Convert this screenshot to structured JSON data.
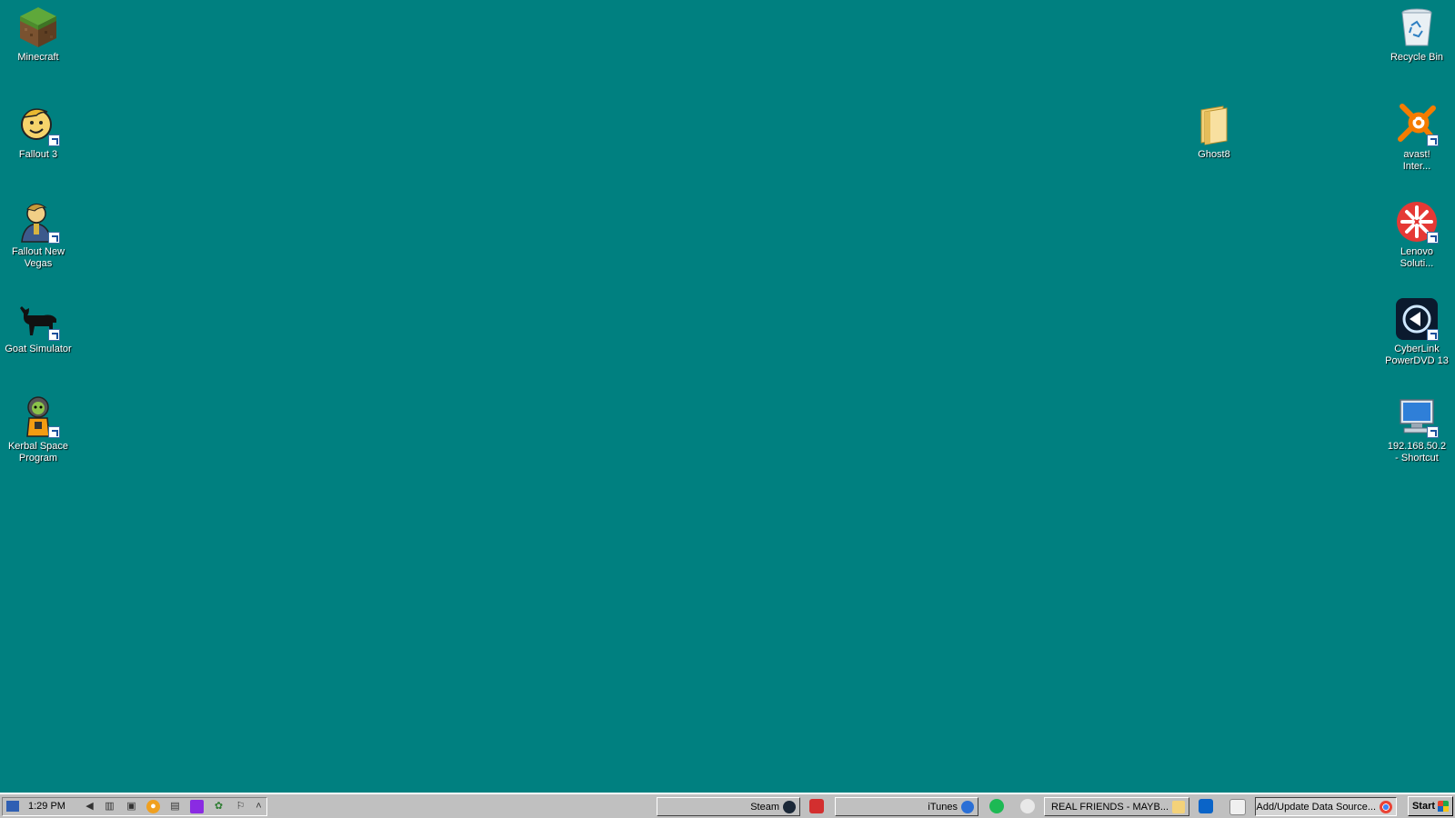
{
  "desktop": {
    "background": "#008080",
    "icons_left": [
      {
        "label": "Minecraft",
        "icon": "minecraft-grass-block-icon",
        "shortcut": false
      },
      {
        "label": "Fallout 3",
        "icon": "vault-boy-icon",
        "shortcut": true
      },
      {
        "label": "Fallout New\nVegas",
        "icon": "vault-boy-new-vegas-icon",
        "shortcut": true
      },
      {
        "label": "Goat Simulator",
        "icon": "goat-icon",
        "shortcut": true
      },
      {
        "label": "Kerbal Space\nProgram",
        "icon": "kerbal-icon",
        "shortcut": true
      }
    ],
    "icons_middle": [
      {
        "label": "Ghost8",
        "icon": "folder-icon",
        "shortcut": false
      }
    ],
    "icons_right": [
      {
        "label": "Recycle Bin",
        "icon": "recycle-bin-icon",
        "shortcut": false
      },
      {
        "label": "avast!\nInter...",
        "icon": "avast-icon",
        "shortcut": true
      },
      {
        "label": "Lenovo\nSoluti...",
        "icon": "lenovo-solutions-icon",
        "shortcut": true
      },
      {
        "label": "CyberLink\nPowerDVD 13",
        "icon": "powerdvd-icon",
        "shortcut": true
      },
      {
        "label": "192.168.50.2\n- Shortcut",
        "icon": "network-computer-icon",
        "shortcut": true
      }
    ]
  },
  "taskbar": {
    "start_label": "Start",
    "tasks": [
      {
        "label": "Add/Update Data Source...",
        "icon": "chrome-icon"
      },
      {
        "label": "REAL FRIENDS - MAYB...",
        "icon": "folder-icon"
      },
      {
        "label": "iTunes",
        "icon": "itunes-icon"
      },
      {
        "label": "Steam",
        "icon": "steam-icon"
      }
    ],
    "quick_launch": [
      "calculator-icon",
      "outlook-icon",
      "alien-icon",
      "spotify-icon",
      "red-app-icon"
    ],
    "tray": {
      "clock": "1:29 PM",
      "icons": [
        "show-desktop-icon",
        "volume-icon",
        "network-icon",
        "device-icon",
        "update-icon",
        "film-icon",
        "purple-app-icon",
        "globe-icon",
        "flag-icon",
        "up-arrow-icon"
      ]
    }
  }
}
